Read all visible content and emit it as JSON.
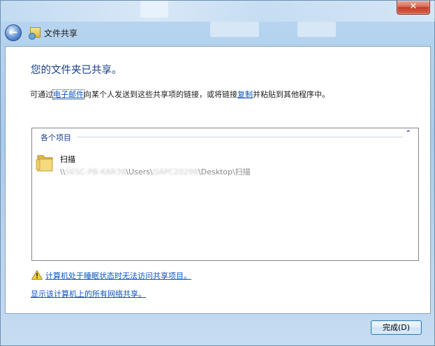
{
  "window": {
    "title": "文件共享",
    "close_glyph": "✕",
    "back_glyph": "←"
  },
  "content": {
    "heading": "您的文件夹已共享。",
    "desc_part1": "可通过",
    "email_link": "电子邮件",
    "desc_part2": "向某个人发送到这些共享项的链接，或将链接",
    "copy_link": "复制",
    "desc_part3": "并粘贴到其他程序中。"
  },
  "items_group": {
    "label": "各个项目",
    "collapse_glyph": "⌃",
    "items": [
      {
        "name": "扫描",
        "path_prefix": "\\\\",
        "path_machine": "SESC-PB-KAR38",
        "path_mid1": "\\Users\\",
        "path_user": "GAPC20298",
        "path_tail": "\\Desktop\\扫描"
      }
    ]
  },
  "links": {
    "sleep_warning": "计算机处于睡眠状态时无法访问共享项目。",
    "show_all_shares": "显示该计算机上的所有网络共享。"
  },
  "footer": {
    "done_button": "完成(D)"
  },
  "colors": {
    "heading": "#1a3f86",
    "link": "#0b55c4",
    "close_red": "#c33d25"
  }
}
